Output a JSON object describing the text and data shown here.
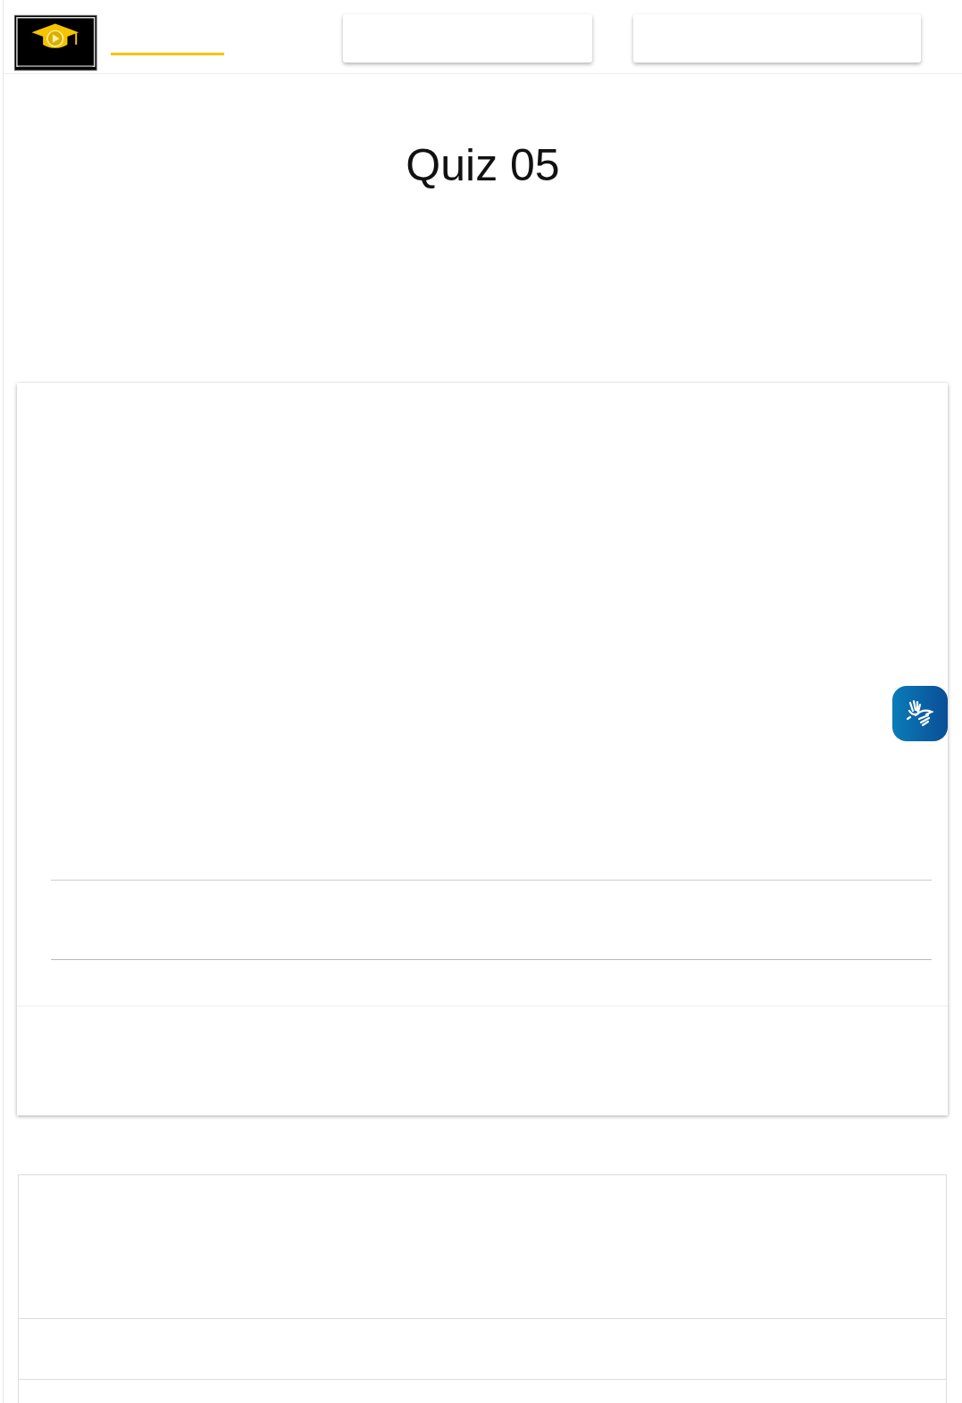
{
  "page": {
    "title": "Quiz 05"
  }
}
